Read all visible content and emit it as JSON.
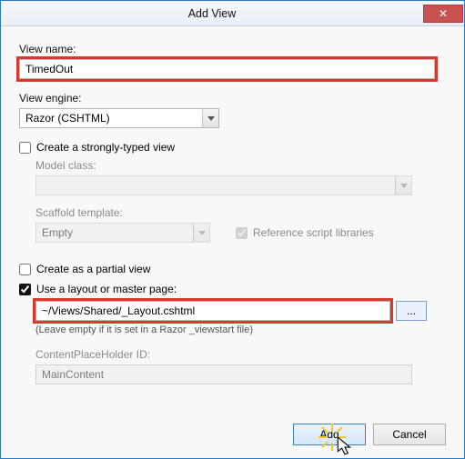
{
  "window": {
    "title": "Add View"
  },
  "viewName": {
    "label": "View name:",
    "value": "TimedOut"
  },
  "viewEngine": {
    "label": "View engine:",
    "value": "Razor (CSHTML)"
  },
  "stronglyTyped": {
    "label": "Create a strongly-typed view",
    "modelClassLabel": "Model class:",
    "modelClassValue": "",
    "scaffoldLabel": "Scaffold template:",
    "scaffoldValue": "Empty",
    "refLibrariesLabel": "Reference script libraries"
  },
  "partialView": {
    "label": "Create as a partial view"
  },
  "layout": {
    "label": "Use a layout or master page:",
    "value": "~/Views/Shared/_Layout.cshtml",
    "hint": "(Leave empty if it is set in a Razor _viewstart file)",
    "browseLabel": "...",
    "placeholderLabel": "ContentPlaceHolder ID:",
    "placeholderValue": "MainContent"
  },
  "buttons": {
    "add": "Add",
    "cancel": "Cancel",
    "close": "✕"
  }
}
